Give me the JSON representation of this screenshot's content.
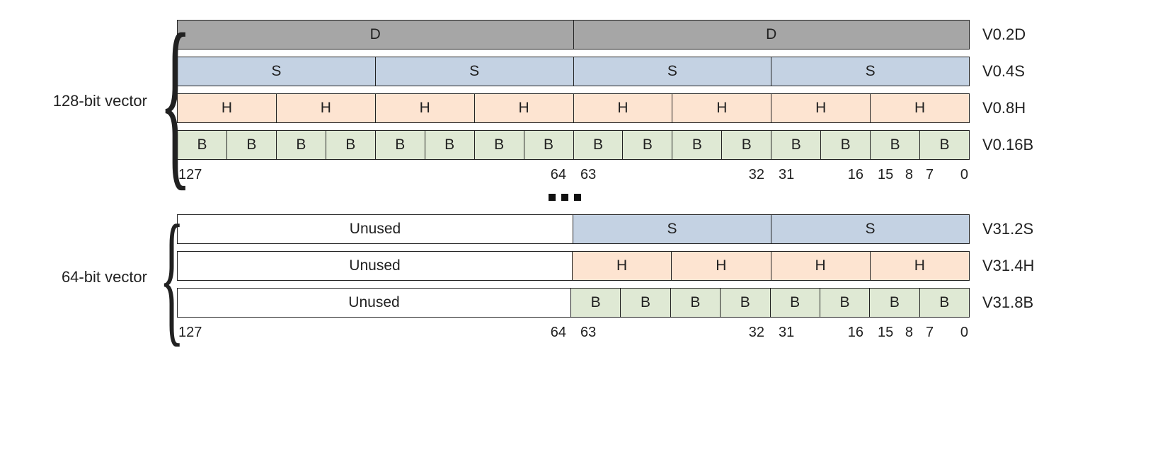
{
  "labels": {
    "group128": "128-bit vector",
    "group64": "64-bit vector",
    "unused": "Unused"
  },
  "letters": {
    "D": "D",
    "S": "S",
    "H": "H",
    "B": "B"
  },
  "rowNames": {
    "v0_2d": "V0.2D",
    "v0_4s": "V0.4S",
    "v0_8h": "V0.8H",
    "v0_16b": "V0.16B",
    "v31_2s": "V31.2S",
    "v31_4h": "V31.4H",
    "v31_8b": "V31.8B"
  },
  "bits": {
    "b127": "127",
    "b64": "64",
    "b63": "63",
    "b32": "32",
    "b31": "31",
    "b16": "16",
    "b15": "15",
    "b8": "8",
    "b7": "7",
    "b0": "0"
  },
  "chart_data": {
    "type": "table",
    "title": "ARM NEON / SIMD vector register lane arrangements",
    "register_width_bits": 128,
    "groups": [
      {
        "label": "128-bit vector",
        "width_bits": 128,
        "arrangements": [
          {
            "name": "V0.2D",
            "lanes": 2,
            "lane_width_bits": 64,
            "lane_symbol": "D",
            "unused_high_bits": 0
          },
          {
            "name": "V0.4S",
            "lanes": 4,
            "lane_width_bits": 32,
            "lane_symbol": "S",
            "unused_high_bits": 0
          },
          {
            "name": "V0.8H",
            "lanes": 8,
            "lane_width_bits": 16,
            "lane_symbol": "H",
            "unused_high_bits": 0
          },
          {
            "name": "V0.16B",
            "lanes": 16,
            "lane_width_bits": 8,
            "lane_symbol": "B",
            "unused_high_bits": 0
          }
        ]
      },
      {
        "label": "64-bit vector",
        "width_bits": 64,
        "arrangements": [
          {
            "name": "V31.2S",
            "lanes": 2,
            "lane_width_bits": 32,
            "lane_symbol": "S",
            "unused_high_bits": 64
          },
          {
            "name": "V31.4H",
            "lanes": 4,
            "lane_width_bits": 16,
            "lane_symbol": "H",
            "unused_high_bits": 64
          },
          {
            "name": "V31.8B",
            "lanes": 8,
            "lane_width_bits": 8,
            "lane_symbol": "B",
            "unused_high_bits": 64
          }
        ]
      }
    ],
    "bit_ruler": [
      127,
      64,
      63,
      32,
      31,
      16,
      15,
      8,
      7,
      0
    ]
  }
}
